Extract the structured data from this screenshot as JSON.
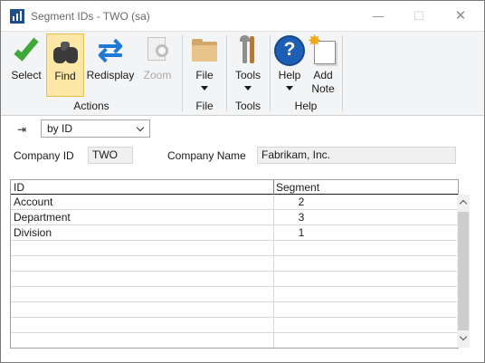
{
  "window": {
    "title": "Segment IDs  -  TWO (sa)",
    "controls": {
      "minimize": "—",
      "maximize": "☐",
      "close": "✕"
    }
  },
  "ribbon": {
    "buttons": [
      {
        "label": "Select",
        "icon": "checkmark-icon"
      },
      {
        "label": "Find",
        "icon": "binoculars-icon",
        "active": true
      },
      {
        "label": "Redisplay",
        "icon": "refresh-icon"
      },
      {
        "label": "Zoom",
        "icon": "zoom-icon",
        "disabled": true
      },
      {
        "label": "File",
        "icon": "folder-icon"
      },
      {
        "label": "Tools",
        "icon": "tools-icon"
      },
      {
        "label": "Help",
        "icon": "help-icon"
      },
      {
        "label": "Add\nNote",
        "icon": "add-note-icon"
      }
    ],
    "groups": [
      "Actions",
      "File",
      "Tools",
      "Help"
    ],
    "help_glyph": "?",
    "star_glyph": "✸",
    "redisplay_glyph": "⇄"
  },
  "sort": {
    "pin_glyph": "⇥",
    "selected": "by ID"
  },
  "company": {
    "id_label": "Company ID",
    "id_value": "TWO",
    "name_label": "Company Name",
    "name_value": "Fabrikam, Inc."
  },
  "grid": {
    "columns": [
      "ID",
      "Segment"
    ],
    "rows": [
      {
        "id": "Account",
        "segment": "2"
      },
      {
        "id": "Department",
        "segment": "3"
      },
      {
        "id": "Division",
        "segment": "1"
      }
    ]
  },
  "colors": {
    "ribbon_bg": "#f3f4f6",
    "active_button": "#fde7a6",
    "accent_blue": "#1d5fb4",
    "check_green": "#3fa83a"
  }
}
